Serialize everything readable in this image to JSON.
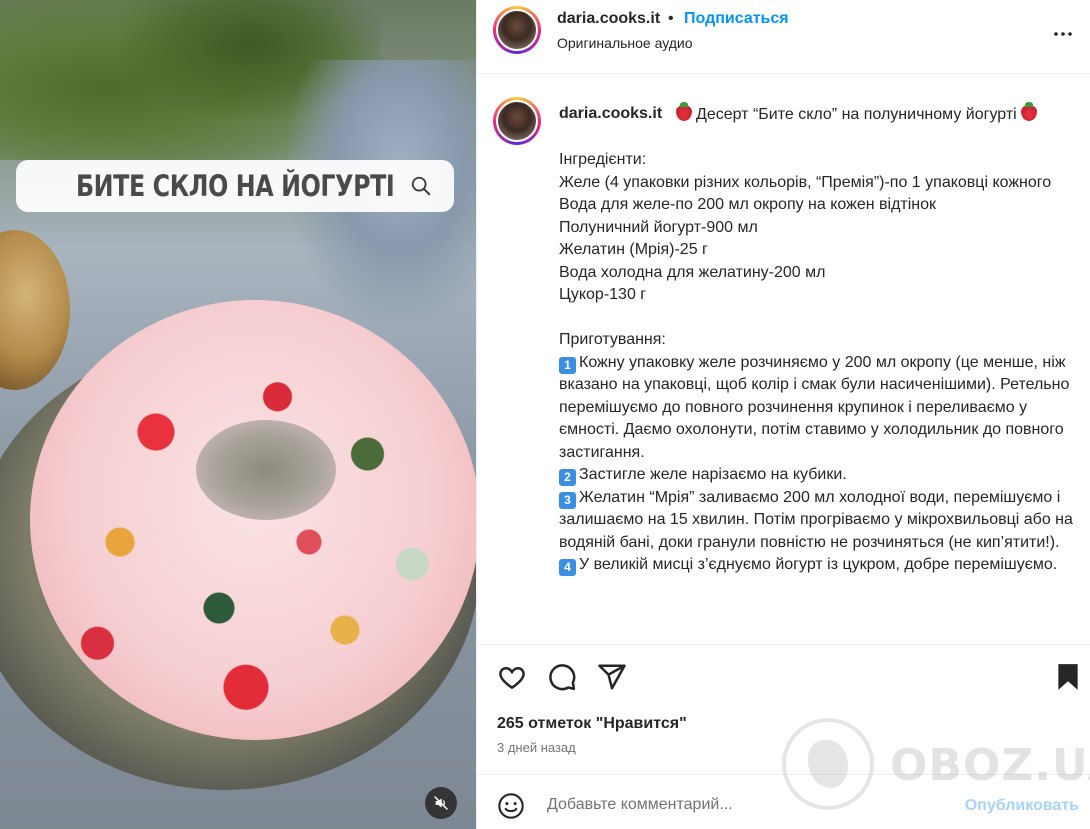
{
  "media": {
    "overlay_title": "БИТЕ СКЛО НА ЙОГУРТІ"
  },
  "header": {
    "username": "daria.cooks.it",
    "separator": "•",
    "follow_label": "Подписаться",
    "audio_label": "Оригинальное аудио"
  },
  "caption": {
    "username": "daria.cooks.it",
    "headline": "Десерт “Бите скло” на полуничному йогурті",
    "ingredients_title": "Інгредієнти:",
    "ingredients": [
      "Желе (4 упаковки різних кольорів, “Премія”)-по 1 упаковці кожного",
      "Вода для желе-по 200 мл окропу на кожен відтінок",
      "Полуничний йогурт-900 мл",
      "Желатин (Мрія)-25 г",
      "Вода холодна для желатину-200 мл",
      "Цукор-130 г"
    ],
    "steps_title": "Приготування:",
    "steps": [
      {
        "num": "1",
        "text": "Кожну упаковку желе розчиняємо у 200 мл окропу (це менше, ніж вказано на упаковці, щоб колір і смак були насиченішими). Ретельно перемішуємо до повного розчинення крупинок і переливаємо у ємності. Даємо охолонути, потім ставимо у холодильник до повного застигання."
      },
      {
        "num": "2",
        "text": "Застигле желе нарізаємо на кубики."
      },
      {
        "num": "3",
        "text": "Желатин “Мрія” заливаємо 200 мл холодної води, перемішуємо і залишаємо на 15 хвилин. Потім прогріваємо у мікрохвильовці або на водяній бані, доки гранули повністю не розчиняться (не кип’ятити!)."
      },
      {
        "num": "4",
        "text": "У великій мисці з’єднуємо йогурт із цукром, добре перемішуємо."
      }
    ]
  },
  "actions": {
    "likes": "265 отметок \"Нравится\"",
    "time": "3 дней назад"
  },
  "comment": {
    "placeholder": "Добавьте комментарий...",
    "publish_label": "Опубликовать"
  },
  "watermark": {
    "text": "OBOZ.UA"
  },
  "icons": {
    "like": "heart-icon",
    "comment": "comment-icon",
    "share": "share-icon",
    "save": "bookmark-icon",
    "more": "more-icon",
    "emoji": "smile-icon",
    "mute": "mute-icon",
    "search": "search-icon"
  },
  "colors": {
    "link_blue": "#0095f6",
    "publish_disabled": "#a8d4f8",
    "text": "#262626",
    "secondary": "#737373"
  }
}
